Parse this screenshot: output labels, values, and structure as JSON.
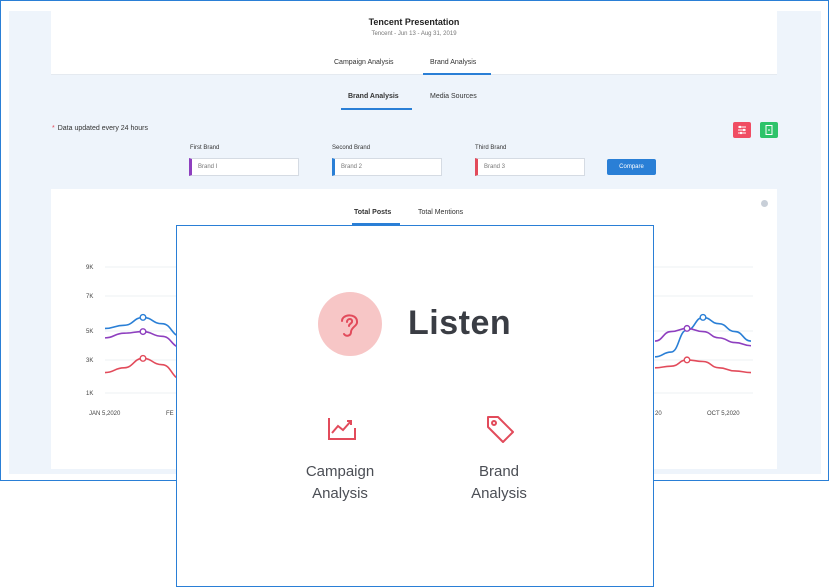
{
  "header": {
    "title": "Tencent Presentation",
    "subtitle": "Tencent - Jun 13 - Aug 31, 2019",
    "tabs": [
      {
        "label": "Campaign Analysis",
        "active": false
      },
      {
        "label": "Brand Analysis",
        "active": true
      }
    ]
  },
  "subtabs": [
    {
      "label": "Brand Analysis",
      "active": true
    },
    {
      "label": "Media Sources",
      "active": false
    }
  ],
  "data_note": {
    "star": "*",
    "text": "Data updated every 24 hours"
  },
  "actions": {
    "filter_icon": "sliders-icon",
    "export_icon": "document-icon",
    "filter_color": "#f04d63",
    "export_color": "#2ec36a"
  },
  "brands": [
    {
      "label": "First Brand",
      "value": "Brand I",
      "color": "#8e3fbf"
    },
    {
      "label": "Second Brand",
      "value": "Brand 2",
      "color": "#2a7fd6"
    },
    {
      "label": "Third  Brand",
      "value": "Brand 3",
      "color": "#e24b5b"
    }
  ],
  "compare_label": "Compare",
  "chart_tabs": [
    {
      "label": "Total Posts",
      "active": true
    },
    {
      "label": "Total Mentions",
      "active": false
    }
  ],
  "chart_data": {
    "type": "line",
    "y_ticks": [
      "9K",
      "7K",
      "5K",
      "3K",
      "1K"
    ],
    "x_tick_labels_visible": [
      "JAN 5,2020",
      "FE",
      "20",
      "OCT 5,2020"
    ],
    "series": [
      {
        "color": "#2a7fd6",
        "segments": [
          [
            [
              0,
              5.1
            ],
            [
              0.1,
              5.3
            ],
            [
              0.2,
              5.8
            ],
            [
              0.3,
              5.4
            ],
            [
              0.4,
              4.6
            ]
          ],
          [
            [
              0.88,
              3.3
            ],
            [
              0.92,
              3.6
            ],
            [
              0.96,
              5.0
            ],
            [
              1.0,
              5.8
            ],
            [
              1.04,
              5.4
            ],
            [
              1.08,
              4.9
            ],
            [
              1.12,
              4.3
            ]
          ]
        ]
      },
      {
        "color": "#8e3fbf",
        "segments": [
          [
            [
              0,
              4.5
            ],
            [
              0.1,
              4.8
            ],
            [
              0.2,
              4.9
            ],
            [
              0.3,
              4.6
            ],
            [
              0.4,
              3.9
            ]
          ],
          [
            [
              0.88,
              4.3
            ],
            [
              0.92,
              4.9
            ],
            [
              0.96,
              5.1
            ],
            [
              1.0,
              4.9
            ],
            [
              1.04,
              4.5
            ],
            [
              1.08,
              4.2
            ],
            [
              1.12,
              4.0
            ]
          ]
        ]
      },
      {
        "color": "#e24b5b",
        "segments": [
          [
            [
              0,
              2.3
            ],
            [
              0.1,
              2.6
            ],
            [
              0.2,
              3.2
            ],
            [
              0.3,
              2.8
            ],
            [
              0.4,
              1.9
            ]
          ],
          [
            [
              0.88,
              2.6
            ],
            [
              0.92,
              2.7
            ],
            [
              0.96,
              3.1
            ],
            [
              1.0,
              3.0
            ],
            [
              1.04,
              2.6
            ],
            [
              1.08,
              2.4
            ],
            [
              1.12,
              2.3
            ]
          ]
        ]
      }
    ],
    "grid": true
  },
  "overlay": {
    "icon": "ear-icon",
    "title": "Listen",
    "options": [
      {
        "icon": "trend-chart-icon",
        "line1": "Campaign",
        "line2": "Analysis"
      },
      {
        "icon": "tag-icon",
        "line1": "Brand",
        "line2": "Analysis"
      }
    ],
    "accent": "#e24b5b"
  }
}
